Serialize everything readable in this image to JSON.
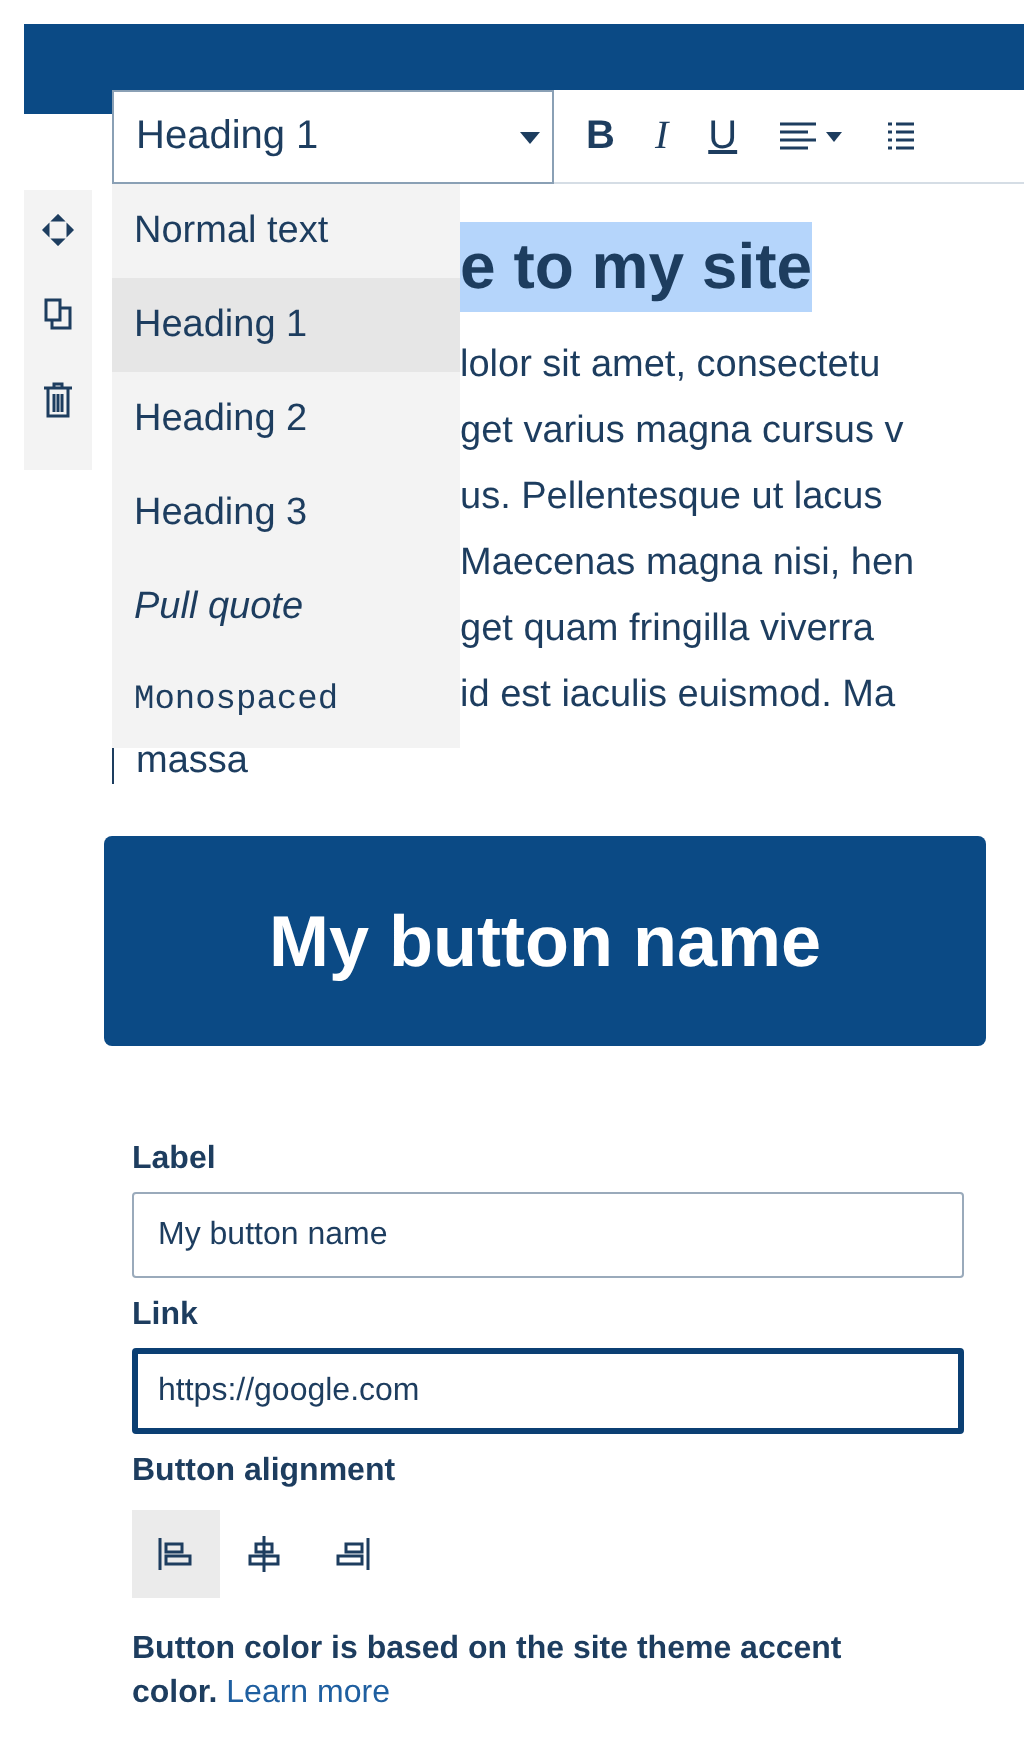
{
  "toolbar": {
    "style_select": {
      "value": "Heading 1"
    },
    "bold": "B",
    "italic": "I",
    "underline": "U"
  },
  "style_menu": {
    "items": [
      {
        "label": "Normal text",
        "kind": "sans",
        "selected": false
      },
      {
        "label": "Heading 1",
        "kind": "sans",
        "selected": true
      },
      {
        "label": "Heading 2",
        "kind": "sans",
        "selected": false
      },
      {
        "label": "Heading 3",
        "kind": "sans",
        "selected": false
      },
      {
        "label": "Pull quote",
        "kind": "italic",
        "selected": false
      },
      {
        "label": "Monospaced",
        "kind": "mono",
        "selected": false
      }
    ]
  },
  "editor": {
    "heading": "e to my site",
    "lines": [
      "lolor sit amet, consectetu",
      "get varius magna cursus v",
      "us. Pellentesque ut lacus",
      "Maecenas magna nisi, hen",
      "get quam fringilla viverra",
      "id est iaculis euismod. Ma"
    ],
    "last_line": "massa"
  },
  "button": {
    "label": "My button name"
  },
  "form": {
    "fields": [
      {
        "label": "Label",
        "value": "My button name",
        "focused": false
      },
      {
        "label": "Link",
        "value": "https://google.com",
        "focused": true
      }
    ],
    "alignment": {
      "label": "Button alignment",
      "options": [
        {
          "kind": "left",
          "selected": true
        },
        {
          "kind": "center",
          "selected": false
        },
        {
          "kind": "right",
          "selected": false
        }
      ]
    },
    "note": {
      "text": "Button color is based on the site theme accent color.",
      "link": "Learn more"
    }
  }
}
